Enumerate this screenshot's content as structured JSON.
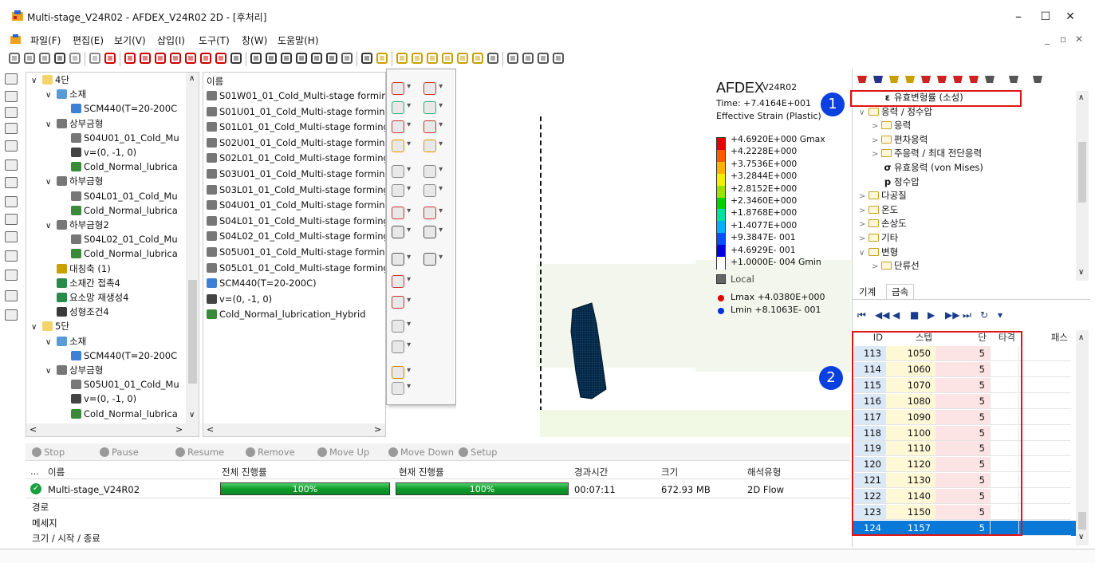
{
  "window": {
    "title": "Multi-stage_V24R02 - AFDEX_V24R02 2D - [후처리]",
    "min": "–",
    "max": "☐",
    "close": "✕"
  },
  "menu": [
    "파일(F)",
    "편집(E)",
    "보기(V)",
    "삽입(I)",
    "도구(T)",
    "창(W)",
    "도움말(H)"
  ],
  "mdi": {
    "min": "_",
    "restore": "▫",
    "close": "✕"
  },
  "tree": [
    {
      "label": "4단",
      "level": 0,
      "exp": "∨",
      "icon": "folder"
    },
    {
      "label": "소재",
      "level": 1,
      "exp": "∨",
      "icon": "material"
    },
    {
      "label": "SCM440(T=20-200C",
      "level": 2,
      "exp": "",
      "icon": "scm"
    },
    {
      "label": "상부금형",
      "level": 1,
      "exp": "∨",
      "icon": "die"
    },
    {
      "label": "S04U01_01_Cold_Mu",
      "level": 2,
      "exp": "",
      "icon": "die"
    },
    {
      "label": "v=(0, -1, 0)",
      "level": 2,
      "exp": "",
      "icon": "vel"
    },
    {
      "label": "Cold_Normal_lubrica",
      "level": 2,
      "exp": "",
      "icon": "lub"
    },
    {
      "label": "하부금형",
      "level": 1,
      "exp": "∨",
      "icon": "die"
    },
    {
      "label": "S04L01_01_Cold_Mu",
      "level": 2,
      "exp": "",
      "icon": "die"
    },
    {
      "label": "Cold_Normal_lubrica",
      "level": 2,
      "exp": "",
      "icon": "lub"
    },
    {
      "label": "하부금형2",
      "level": 1,
      "exp": "∨",
      "icon": "die"
    },
    {
      "label": "S04L02_01_Cold_Mu",
      "level": 2,
      "exp": "",
      "icon": "die"
    },
    {
      "label": "Cold_Normal_lubrica",
      "level": 2,
      "exp": "",
      "icon": "lub"
    },
    {
      "label": "대칭축 (1)",
      "level": 1,
      "exp": "",
      "icon": "axis"
    },
    {
      "label": "소재간 접촉4",
      "level": 1,
      "exp": "",
      "icon": "contact"
    },
    {
      "label": "요소망 재생성4",
      "level": 1,
      "exp": "",
      "icon": "mesh"
    },
    {
      "label": "성형조건4",
      "level": 1,
      "exp": "",
      "icon": "cond"
    },
    {
      "label": "5단",
      "level": 0,
      "exp": "∨",
      "icon": "folder"
    },
    {
      "label": "소재",
      "level": 1,
      "exp": "∨",
      "icon": "material"
    },
    {
      "label": "SCM440(T=20-200C",
      "level": 2,
      "exp": "",
      "icon": "scm"
    },
    {
      "label": "상부금형",
      "level": 1,
      "exp": "∨",
      "icon": "die"
    },
    {
      "label": "S05U01_01_Cold_Mu",
      "level": 2,
      "exp": "",
      "icon": "die"
    },
    {
      "label": "v=(0, -1, 0)",
      "level": 2,
      "exp": "",
      "icon": "vel"
    },
    {
      "label": "Cold_Normal_lubrica",
      "level": 2,
      "exp": "",
      "icon": "lub"
    }
  ],
  "list": {
    "header": "이름",
    "items": [
      {
        "label": "S01W01_01_Cold_Multi-stage formin",
        "icon": "die"
      },
      {
        "label": "S01U01_01_Cold_Multi-stage forming",
        "icon": "die"
      },
      {
        "label": "S01L01_01_Cold_Multi-stage forming",
        "icon": "die"
      },
      {
        "label": "S02U01_01_Cold_Multi-stage forming",
        "icon": "die"
      },
      {
        "label": "S02L01_01_Cold_Multi-stage forming",
        "icon": "die"
      },
      {
        "label": "S03U01_01_Cold_Multi-stage forming",
        "icon": "die"
      },
      {
        "label": "S03L01_01_Cold_Multi-stage forming",
        "icon": "die"
      },
      {
        "label": "S04U01_01_Cold_Multi-stage forming",
        "icon": "die"
      },
      {
        "label": "S04L01_01_Cold_Multi-stage forming",
        "icon": "die"
      },
      {
        "label": "S04L02_01_Cold_Multi-stage forming",
        "icon": "die"
      },
      {
        "label": "S05U01_01_Cold_Multi-stage forming",
        "icon": "die"
      },
      {
        "label": "S05L01_01_Cold_Multi-stage forming",
        "icon": "die"
      },
      {
        "label": "SCM440(T=20-200C)",
        "icon": "scm"
      },
      {
        "label": "v=(0, -1, 0)",
        "icon": "vel"
      },
      {
        "label": "Cold_Normal_lubrication_Hybrid",
        "icon": "lub"
      }
    ]
  },
  "legend": {
    "brand": "AFDEX",
    "version": "V24R02",
    "time": "Time: +7.4164E+001",
    "quantity": "Effective Strain (Plastic)",
    "labels": [
      "+4.6920E+000 Gmax",
      "+4.2228E+000",
      "+3.7536E+000",
      "+3.2844E+000",
      "+2.8152E+000",
      "+2.3460E+000",
      "+1.8768E+000",
      "+1.4077E+000",
      "+9.3847E- 001",
      "+4.6929E- 001",
      "+1.0000E- 004 Gmin"
    ],
    "colors": [
      "#e60000",
      "#ff5a00",
      "#ffb000",
      "#f0f000",
      "#9ee000",
      "#00d000",
      "#00e0a0",
      "#00b0ff",
      "#0050ff",
      "#0000e0",
      "#ffffff"
    ],
    "local": "Local",
    "lmax": "Lmax  +4.0380E+000",
    "lmin": "Lmin  +8.1063E- 001",
    "lmax_color": "#e00000",
    "lmin_color": "#0030e0"
  },
  "result_tree": [
    {
      "label": "유효변형률 (소성)",
      "indent": 1,
      "exp": "",
      "sym": "ε"
    },
    {
      "label": "응력 / 정수압",
      "indent": 0,
      "exp": "∨",
      "sym": "fold"
    },
    {
      "label": "응력",
      "indent": 1,
      "exp": ">",
      "sym": "fold"
    },
    {
      "label": "편차응력",
      "indent": 1,
      "exp": ">",
      "sym": "fold"
    },
    {
      "label": "주응력 / 최대 전단응력",
      "indent": 1,
      "exp": ">",
      "sym": "fold"
    },
    {
      "label": "유효응력 (von Mises)",
      "indent": 1,
      "exp": "",
      "sym": "σ"
    },
    {
      "label": "정수압",
      "indent": 1,
      "exp": "",
      "sym": "p"
    },
    {
      "label": "다공질",
      "indent": 0,
      "exp": ">",
      "sym": "fold"
    },
    {
      "label": "온도",
      "indent": 0,
      "exp": ">",
      "sym": "fold"
    },
    {
      "label": "손상도",
      "indent": 0,
      "exp": ">",
      "sym": "fold"
    },
    {
      "label": "기타",
      "indent": 0,
      "exp": ">",
      "sym": "fold"
    },
    {
      "label": "변형",
      "indent": 0,
      "exp": "∨",
      "sym": "fold"
    },
    {
      "label": "단류선",
      "indent": 1,
      "exp": ">",
      "sym": "fold"
    }
  ],
  "tabs": [
    "기계",
    "금속"
  ],
  "player": {
    "buttons": [
      "first",
      "prev-fast",
      "prev",
      "stop",
      "next",
      "next-fast",
      "last",
      "refresh",
      "more"
    ]
  },
  "grid": {
    "headers": [
      "ID",
      "스텝",
      "단",
      "타격",
      "패스"
    ],
    "rows": [
      {
        "id": "113",
        "step": "1050",
        "stage": "5"
      },
      {
        "id": "114",
        "step": "1060",
        "stage": "5"
      },
      {
        "id": "115",
        "step": "1070",
        "stage": "5"
      },
      {
        "id": "116",
        "step": "1080",
        "stage": "5"
      },
      {
        "id": "117",
        "step": "1090",
        "stage": "5"
      },
      {
        "id": "118",
        "step": "1100",
        "stage": "5"
      },
      {
        "id": "119",
        "step": "1110",
        "stage": "5"
      },
      {
        "id": "120",
        "step": "1120",
        "stage": "5"
      },
      {
        "id": "121",
        "step": "1130",
        "stage": "5"
      },
      {
        "id": "122",
        "step": "1140",
        "stage": "5"
      },
      {
        "id": "123",
        "step": "1150",
        "stage": "5"
      },
      {
        "id": "124",
        "step": "1157",
        "stage": "5",
        "selected": true
      }
    ]
  },
  "badges": [
    "1",
    "2"
  ],
  "jobs": {
    "buttons": [
      "Stop",
      "Pause",
      "Resume",
      "Remove",
      "Move Up",
      "Move Down",
      "Setup"
    ],
    "headers": [
      "...",
      "이름",
      "전체 진행률",
      "현재 진행률",
      "경과시간",
      "크기",
      "해석유형"
    ],
    "row": {
      "name": "Multi-stage_V24R02",
      "total": "100%",
      "current": "100%",
      "elapsed": "00:07:11",
      "size": "672.93 MB",
      "type": "2D Flow",
      "total_progress": 1.0,
      "current_progress": 1.0
    },
    "info": [
      "경로",
      "메세지",
      "크기 / 시작 / 종료"
    ]
  }
}
